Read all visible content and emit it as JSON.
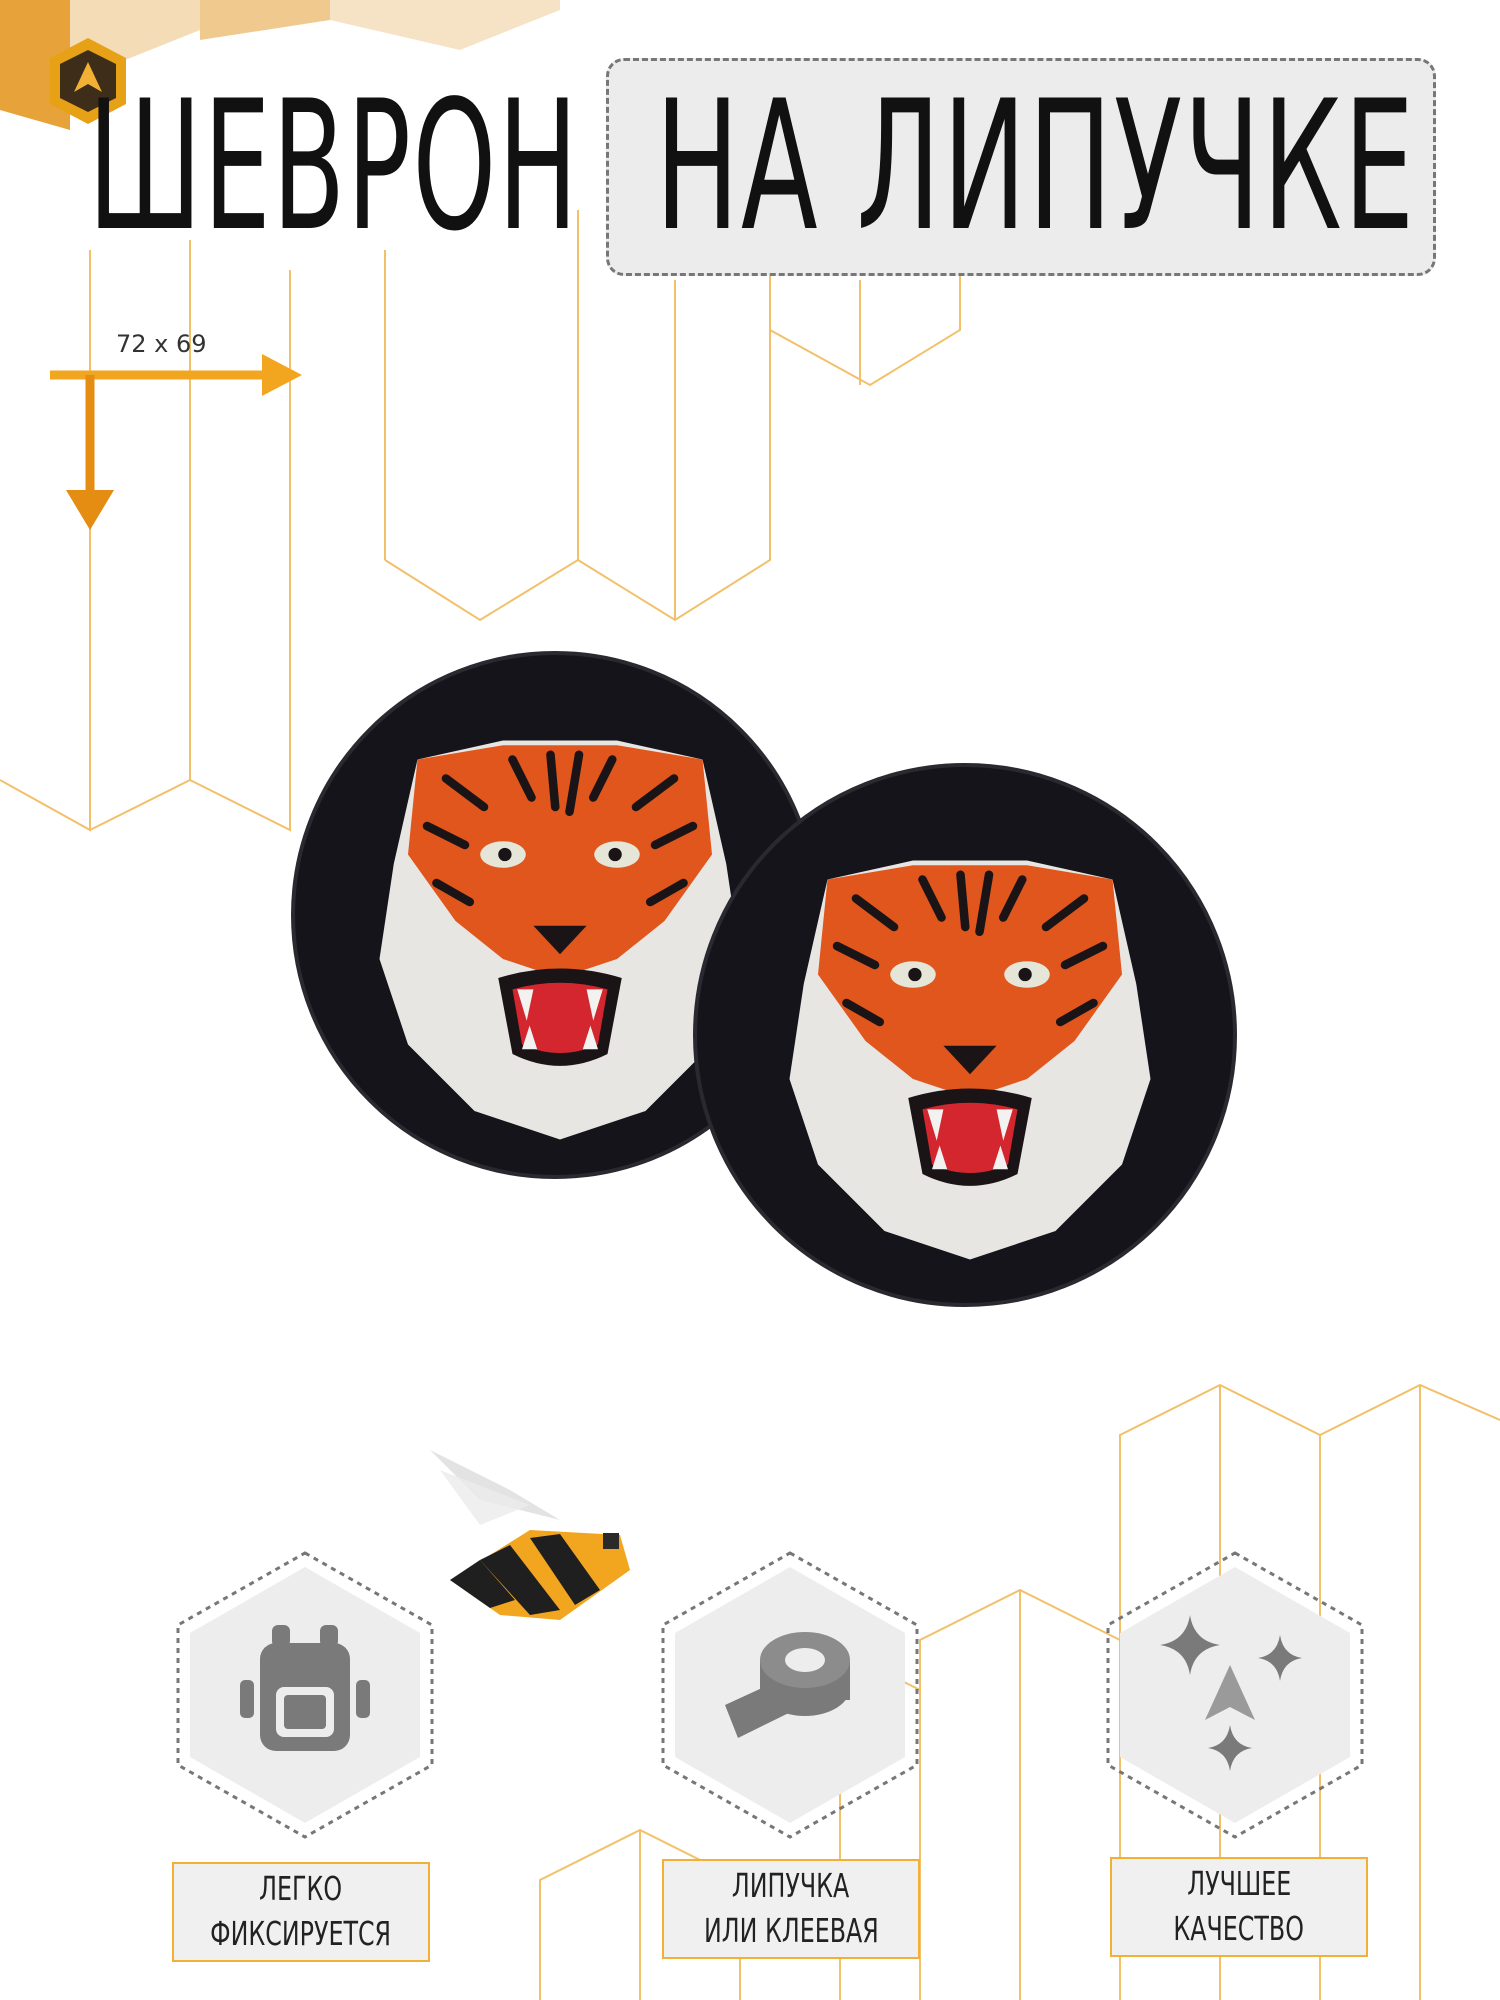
{
  "title": {
    "word1": "ШЕВРОН",
    "word2": "НА ЛИПУЧКЕ"
  },
  "size_label": "72 x 69",
  "colors": {
    "accent": "#f2a51f",
    "arrow": "#e58c12",
    "line": "#f3c06a",
    "icon": "#7a7a7a",
    "patch_bg": "#15141b",
    "tiger_orange": "#e0561d"
  },
  "features": [
    {
      "icon": "backpack-icon",
      "line1": "ЛЕГКО",
      "line2": "ФИКСИРУЕТСЯ"
    },
    {
      "icon": "tape-roll-icon",
      "line1": "ЛИПУЧКА",
      "line2": "ИЛИ КЛЕЕВАЯ"
    },
    {
      "icon": "sparkle-quality-icon",
      "line1": "ЛУЧШЕЕ",
      "line2": "КАЧЕСТВО"
    }
  ]
}
